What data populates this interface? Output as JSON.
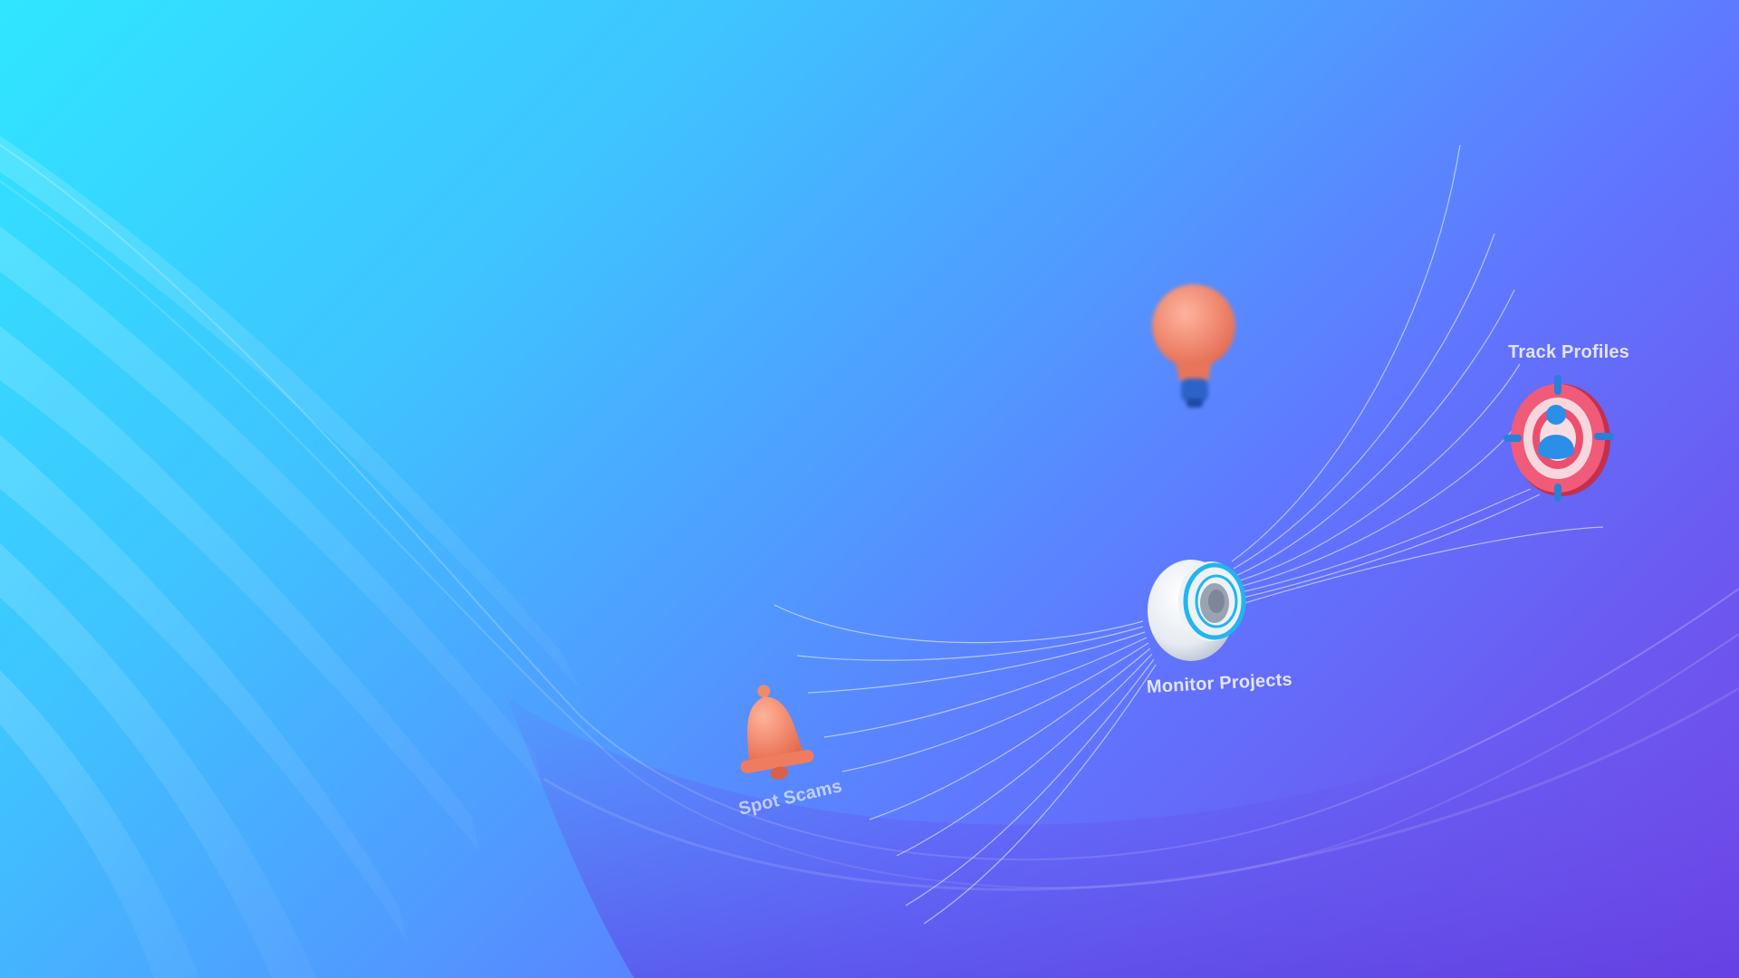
{
  "hero": {
    "labels": {
      "track_profiles": "Track Profiles",
      "monitor_projects": "Monitor Projects",
      "spot_scams": "Spot Scams"
    }
  },
  "icons": {
    "lightbulb": "lightbulb-icon",
    "bell": "bell-icon",
    "speaker": "speaker-icon",
    "target": "target-profile-icon"
  },
  "colors": {
    "gradient_start": "#2fe6ff",
    "gradient_mid": "#4f9dff",
    "gradient_end": "#7443e6",
    "icon_coral": "#f07f63",
    "icon_blue": "#2b8fe8",
    "target_red": "#e84a6a"
  }
}
